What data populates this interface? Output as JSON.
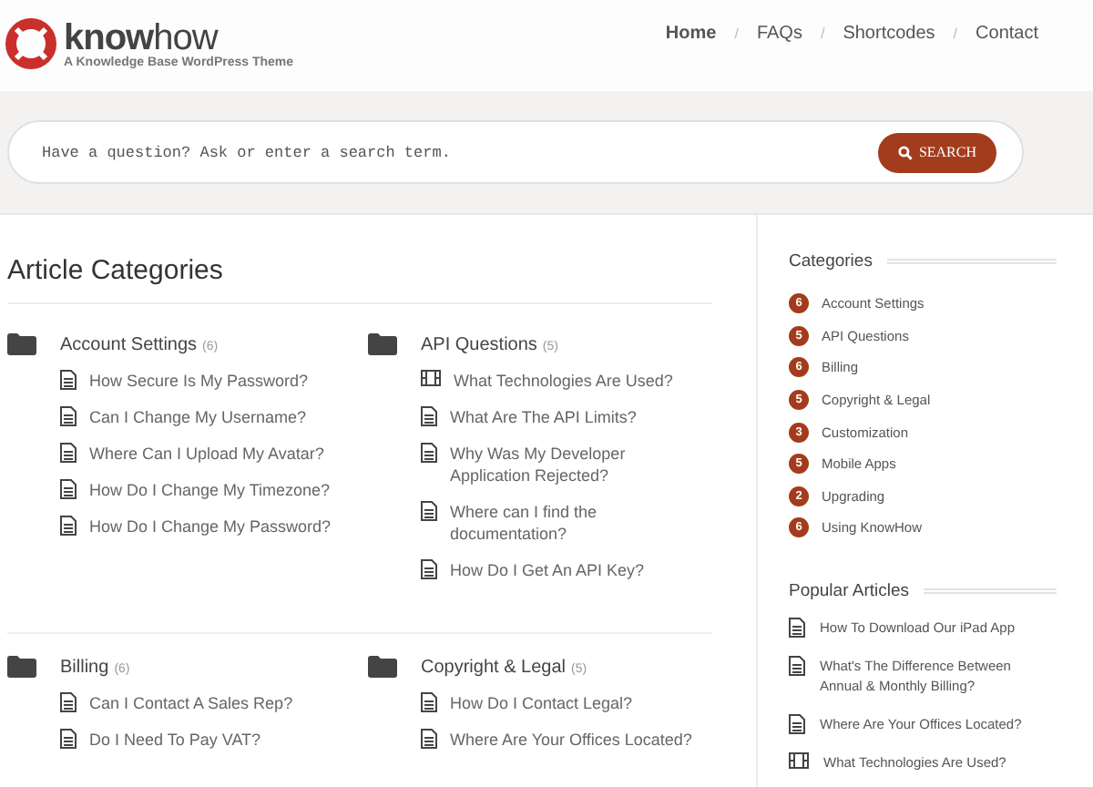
{
  "logo": {
    "brand_bold": "know",
    "brand_light": "how",
    "tagline": "A Knowledge Base WordPress Theme"
  },
  "nav": [
    {
      "label": "Home",
      "selected": true
    },
    {
      "label": "FAQs",
      "selected": false
    },
    {
      "label": "Shortcodes",
      "selected": false
    },
    {
      "label": "Contact",
      "selected": false
    }
  ],
  "nav_separator": "/",
  "search": {
    "placeholder": "Have a question? Ask or enter a search term.",
    "button": "SEARCH"
  },
  "main": {
    "title": "Article Categories",
    "sections": [
      [
        {
          "name": "Account Settings",
          "count": "(6)",
          "articles": [
            {
              "title": "How Secure Is My Password?",
              "kind": "document"
            },
            {
              "title": "Can I Change My Username?",
              "kind": "document"
            },
            {
              "title": "Where Can I Upload My Avatar?",
              "kind": "document"
            },
            {
              "title": "How Do I Change My Timezone?",
              "kind": "document"
            },
            {
              "title": "How Do I Change My Password?",
              "kind": "document"
            }
          ]
        },
        {
          "name": "API Questions",
          "count": "(5)",
          "articles": [
            {
              "title": "What Technologies Are Used?",
              "kind": "video"
            },
            {
              "title": "What Are The API Limits?",
              "kind": "document"
            },
            {
              "title": "Why Was My Developer Application Rejected?",
              "kind": "document"
            },
            {
              "title": "Where can I find the documentation?",
              "kind": "document"
            },
            {
              "title": "How Do I Get An API Key?",
              "kind": "document"
            }
          ]
        }
      ],
      [
        {
          "name": "Billing",
          "count": "(6)",
          "articles": [
            {
              "title": "Can I Contact A Sales Rep?",
              "kind": "document"
            },
            {
              "title": "Do I Need To Pay VAT?",
              "kind": "document"
            }
          ]
        },
        {
          "name": "Copyright & Legal",
          "count": "(5)",
          "articles": [
            {
              "title": "How Do I Contact Legal?",
              "kind": "document"
            },
            {
              "title": "Where Are Your Offices Located?",
              "kind": "document"
            }
          ]
        }
      ]
    ]
  },
  "sidebar": {
    "categories_title": "Categories",
    "categories": [
      {
        "count": "6",
        "name": "Account Settings"
      },
      {
        "count": "5",
        "name": "API Questions"
      },
      {
        "count": "6",
        "name": "Billing"
      },
      {
        "count": "5",
        "name": "Copyright & Legal"
      },
      {
        "count": "3",
        "name": "Customization"
      },
      {
        "count": "5",
        "name": "Mobile Apps"
      },
      {
        "count": "2",
        "name": "Upgrading"
      },
      {
        "count": "6",
        "name": "Using KnowHow"
      }
    ],
    "popular_title": "Popular Articles",
    "popular": [
      {
        "title": "How To Download Our iPad App",
        "kind": "document"
      },
      {
        "title": "What's The Difference Between Annual & Monthly Billing?",
        "kind": "document"
      },
      {
        "title": "Where Are Your Offices Located?",
        "kind": "document"
      },
      {
        "title": "What Technologies Are Used?",
        "kind": "video"
      }
    ]
  }
}
